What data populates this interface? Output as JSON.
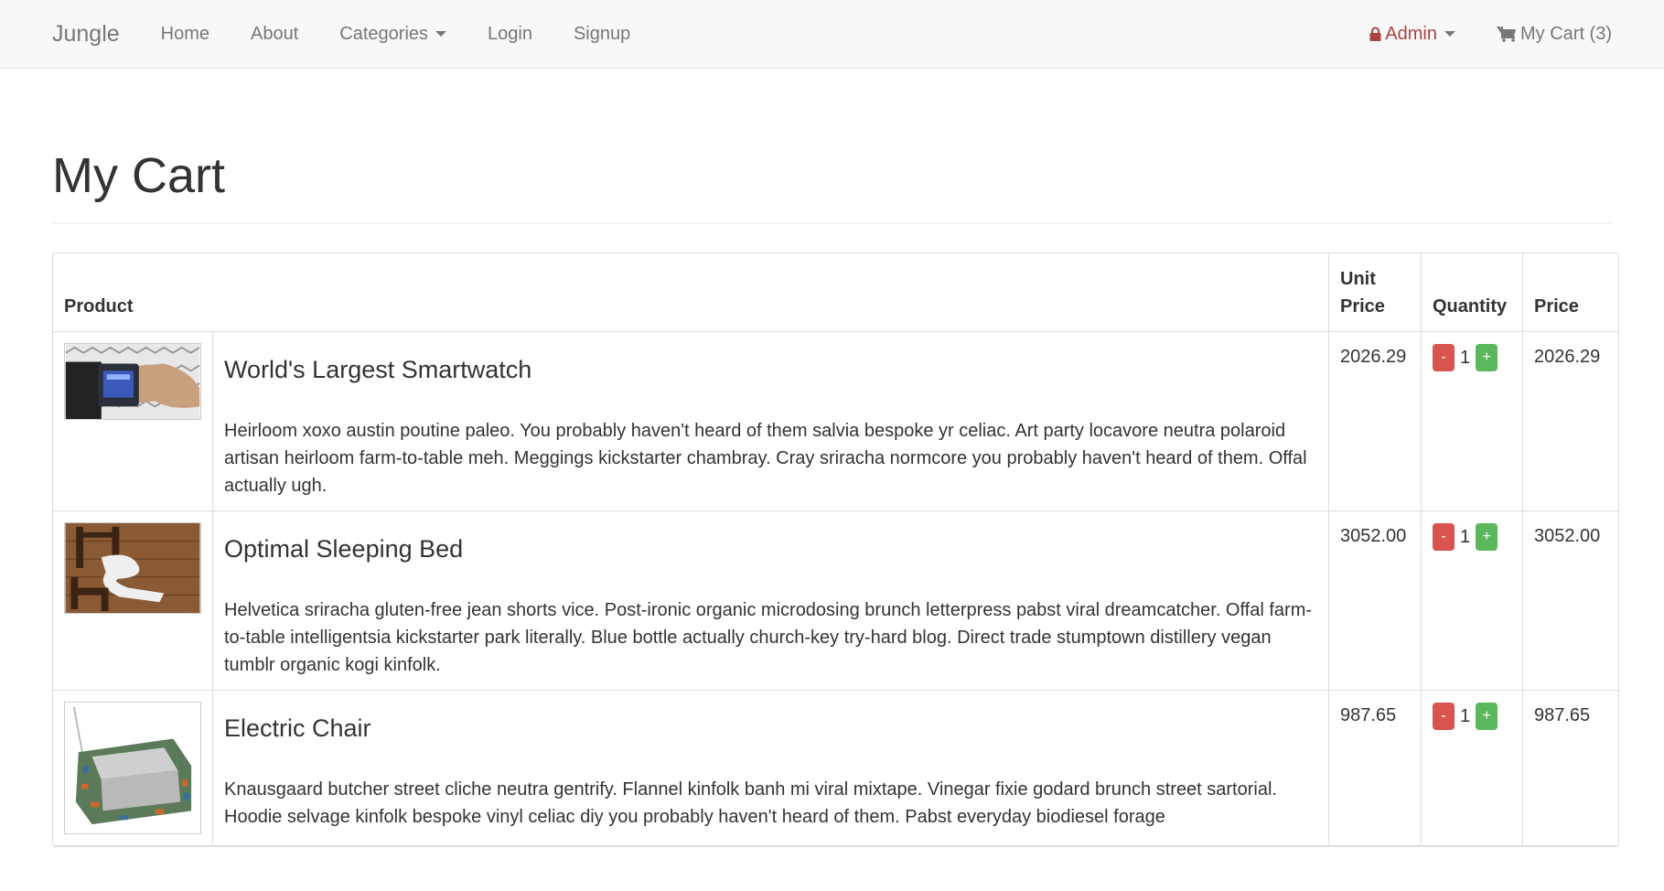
{
  "nav": {
    "brand": "Jungle",
    "items": [
      {
        "label": "Home"
      },
      {
        "label": "About"
      },
      {
        "label": "Categories"
      },
      {
        "label": "Login"
      },
      {
        "label": "Signup"
      }
    ],
    "admin_label": "Admin",
    "cart_label": "My Cart (3)"
  },
  "page": {
    "title": "My Cart"
  },
  "table": {
    "headers": {
      "product": "Product",
      "unit_price_line1": "Unit",
      "unit_price_line2": "Price",
      "quantity": "Quantity",
      "price": "Price"
    },
    "rows": [
      {
        "name": "World's Largest Smartwatch",
        "description": "Heirloom xoxo austin poutine paleo. You probably haven't heard of them salvia bespoke yr celiac. Art party locavore neutra polaroid artisan heirloom farm-to-table meh. Meggings kickstarter chambray. Cray sriracha normcore you probably haven't heard of them. Offal actually ugh.",
        "unit_price": "2026.29",
        "quantity": "1",
        "price": "2026.29"
      },
      {
        "name": "Optimal Sleeping Bed",
        "description": "Helvetica sriracha gluten-free jean shorts vice. Post-ironic organic microdosing brunch letterpress pabst viral dreamcatcher. Offal farm-to-table intelligentsia kickstarter park literally. Blue bottle actually church-key try-hard blog. Direct trade stumptown distillery vegan tumblr organic kogi kinfolk.",
        "unit_price": "3052.00",
        "quantity": "1",
        "price": "3052.00"
      },
      {
        "name": "Electric Chair",
        "description": "Knausgaard butcher street cliche neutra gentrify. Flannel kinfolk banh mi viral mixtape. Vinegar fixie godard brunch street sartorial. Hoodie selvage kinfolk bespoke vinyl celiac diy you probably haven't heard of them. Pabst everyday biodiesel forage",
        "unit_price": "987.65",
        "quantity": "1",
        "price": "987.65"
      }
    ],
    "minus_label": "-",
    "plus_label": "+"
  },
  "icons": {
    "admin": "lock-icon",
    "cart": "shopping-cart-icon",
    "dropdown": "caret-down-icon"
  },
  "colors": {
    "danger": "#d9534f",
    "success": "#5cb85c",
    "admin_text": "#a94442",
    "navbar_bg": "#f8f8f8"
  }
}
